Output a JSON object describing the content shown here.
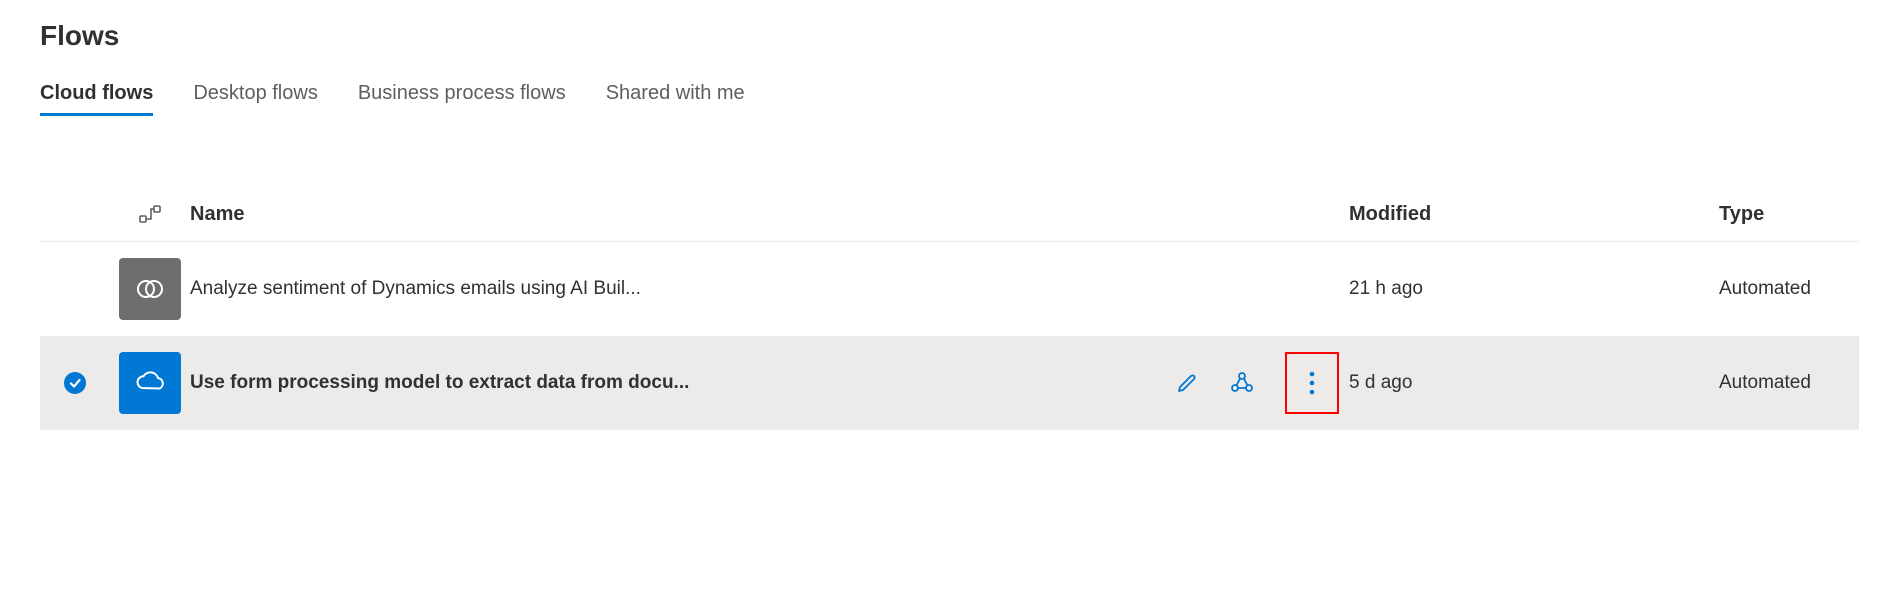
{
  "page": {
    "title": "Flows"
  },
  "tabs": [
    {
      "label": "Cloud flows",
      "active": true
    },
    {
      "label": "Desktop flows",
      "active": false
    },
    {
      "label": "Business process flows",
      "active": false
    },
    {
      "label": "Shared with me",
      "active": false
    }
  ],
  "table": {
    "columns": {
      "name": "Name",
      "modified": "Modified",
      "type": "Type"
    },
    "rows": [
      {
        "selected": false,
        "icon_color": "grey",
        "icon_name": "dynamics-icon",
        "name": "Analyze sentiment of Dynamics emails using AI Buil...",
        "modified": "21 h ago",
        "type": "Automated",
        "show_actions": false
      },
      {
        "selected": true,
        "icon_color": "blue",
        "icon_name": "onedrive-icon",
        "name": "Use form processing model to extract data from docu...",
        "modified": "5 d ago",
        "type": "Automated",
        "show_actions": true
      }
    ]
  }
}
